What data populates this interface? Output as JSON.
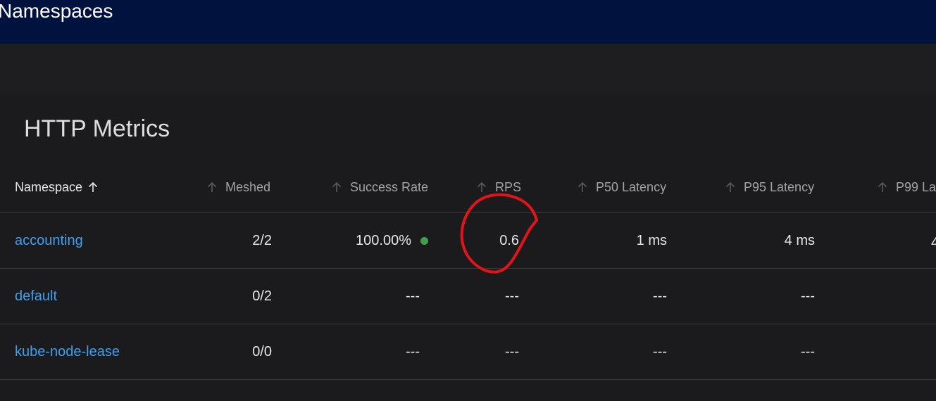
{
  "header": {
    "title": "Namespaces",
    "bg_color": "#00123d"
  },
  "card": {
    "title": "HTTP Metrics"
  },
  "table": {
    "columns": [
      {
        "label": "Namespace"
      },
      {
        "label": "Meshed"
      },
      {
        "label": "Success Rate"
      },
      {
        "label": "RPS"
      },
      {
        "label": "P50 Latency"
      },
      {
        "label": "P95 Latency"
      },
      {
        "label": "P99 La"
      }
    ],
    "rows": [
      {
        "namespace": "accounting",
        "meshed": "2/2",
        "success_rate": "100.00%",
        "rps": "0.6",
        "p50": "1 ms",
        "p95": "4 ms",
        "status_color": "#3fa14a"
      },
      {
        "namespace": "default",
        "meshed": "0/2",
        "success_rate": "---",
        "rps": "---",
        "p50": "---",
        "p95": "---"
      },
      {
        "namespace": "kube-node-lease",
        "meshed": "0/0",
        "success_rate": "---",
        "rps": "---",
        "p50": "---",
        "p95": "---"
      }
    ]
  },
  "colors": {
    "link": "#3f9ff0",
    "annotation": "#e0141a"
  }
}
